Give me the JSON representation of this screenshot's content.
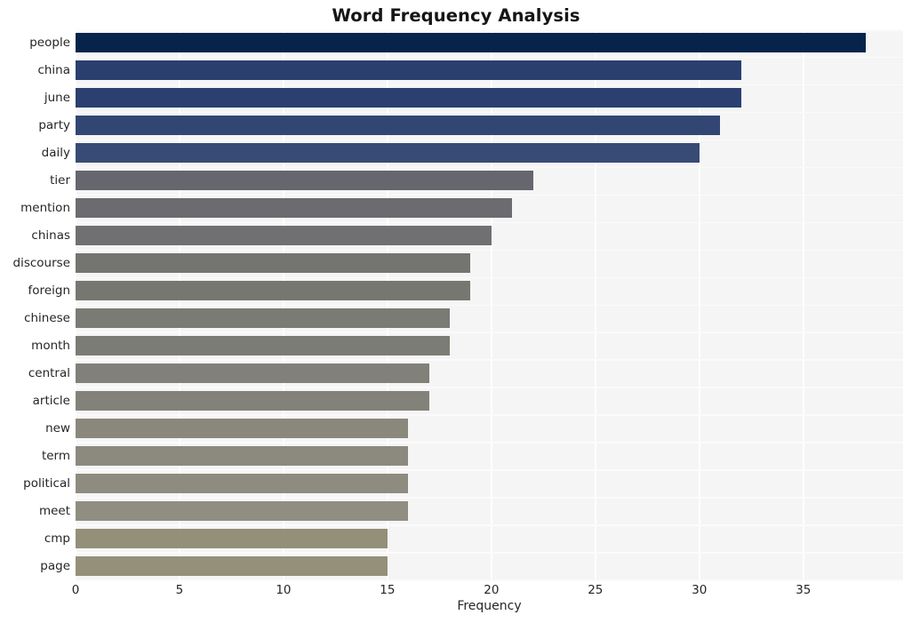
{
  "chart_data": {
    "type": "bar",
    "orientation": "horizontal",
    "title": "Word Frequency Analysis",
    "xlabel": "Frequency",
    "ylabel": "",
    "categories": [
      "people",
      "china",
      "june",
      "party",
      "daily",
      "tier",
      "mention",
      "chinas",
      "discourse",
      "foreign",
      "chinese",
      "month",
      "central",
      "article",
      "new",
      "term",
      "political",
      "meet",
      "cmp",
      "page"
    ],
    "values": [
      38,
      32,
      32,
      31,
      30,
      22,
      21,
      20,
      19,
      19,
      18,
      18,
      17,
      17,
      16,
      16,
      16,
      16,
      15,
      15
    ],
    "bar_colors": [
      "#06234b",
      "#2a3f6e",
      "#2b4070",
      "#324674",
      "#374b74",
      "#66666e",
      "#6b6b70",
      "#707073",
      "#747471",
      "#777772",
      "#7b7b76",
      "#7c7c76",
      "#818079",
      "#83827a",
      "#8a887d",
      "#8c8a7e",
      "#8e8c80",
      "#908e81",
      "#948f79",
      "#95907a"
    ],
    "xlim": [
      0,
      39.8
    ],
    "xticks": [
      0,
      5,
      10,
      15,
      20,
      25,
      30,
      35
    ],
    "xtick_labels": [
      "0",
      "5",
      "10",
      "15",
      "20",
      "25",
      "30",
      "35"
    ],
    "grid": true,
    "grid_color": "#ffffff",
    "plot_background": "#f5f5f6",
    "figure_background": "#ffffff",
    "legend": null
  }
}
